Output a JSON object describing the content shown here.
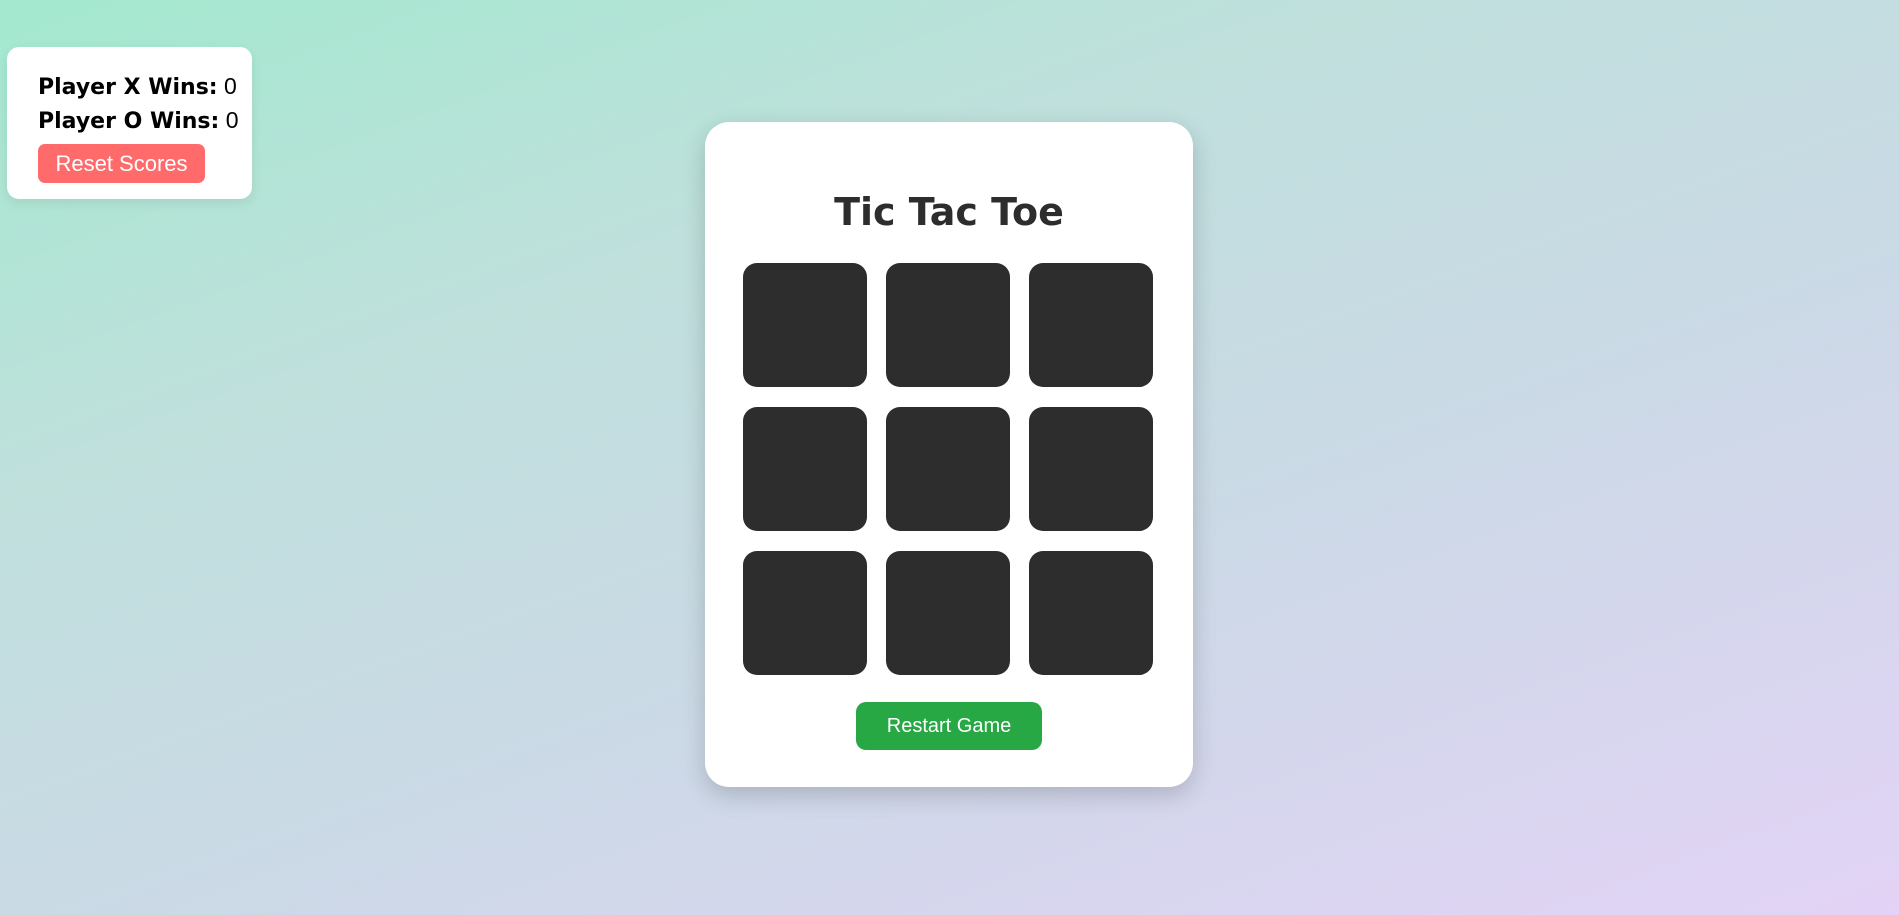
{
  "scoreboard": {
    "player_x_label": "Player X Wins:",
    "player_x_wins": "0",
    "player_o_label": "Player O Wins:",
    "player_o_wins": "0",
    "reset_label": "Reset Scores"
  },
  "game": {
    "title": "Tic Tac Toe",
    "cells": [
      "",
      "",
      "",
      "",
      "",
      "",
      "",
      "",
      ""
    ],
    "restart_label": "Restart Game"
  },
  "colors": {
    "reset_button": "#ff6b6b",
    "restart_button": "#28a745",
    "cell": "#2d2d2d"
  }
}
